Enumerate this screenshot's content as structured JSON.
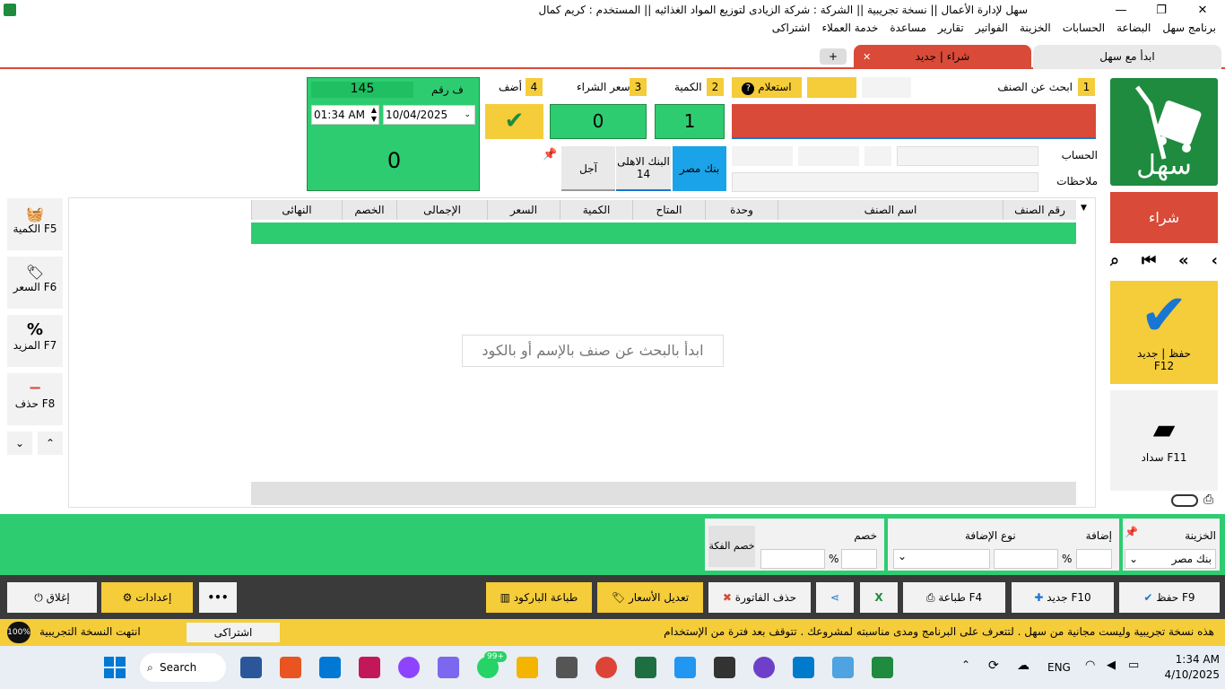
{
  "titlebar": {
    "title": "سهل لإدارة الأعمال   ||  نسخة تجريبية   ||   الشركة : شركة الزيادى لتوزيع المواد الغذائيه   ||   المستخدم : كريم كمال",
    "min": "—",
    "max": "❐",
    "close": "✕"
  },
  "menu": [
    "برنامج سهل",
    "البضاعة",
    "الحسابات",
    "الخزينة",
    "الفواتير",
    "تقارير",
    "مساعدة",
    "خدمة العملاء",
    "اشتراكى"
  ],
  "tabs": {
    "start": "ابدأ مع سهل",
    "active": "شراء | جديد",
    "close": "✕",
    "add": "+"
  },
  "sidebar": {
    "logo_text": "سهل",
    "buy": "شراء",
    "save_new": "حفظ | جديد",
    "save_key": "F12",
    "pay": "سداد F11"
  },
  "entry": {
    "n1": "1",
    "search_label": "ابحث عن الصنف",
    "inquiry": "استعلام",
    "n2": "2",
    "qty_label": "الكمية",
    "qty": "1",
    "n3": "3",
    "price_label": "سعر الشراء",
    "price": "0",
    "n4": "4",
    "add_label": "أضف",
    "account_label": "الحساب",
    "notes_label": "ملاحظات",
    "pay_ahel": "البنك الاهلى",
    "pay_ahel_num": "14",
    "pay_misr": "بنك مصر",
    "pay_credit": "آجل"
  },
  "invoice": {
    "no_label": "ف رقم",
    "no": "145",
    "date": "10/04/2025",
    "time": "01:34 AM",
    "total": "0"
  },
  "leftbtns": [
    {
      "label": "الكمية F5",
      "icon": "basket"
    },
    {
      "label": "السعر F6",
      "icon": "tag"
    },
    {
      "label": "المزيد F7",
      "icon": "percent"
    },
    {
      "label": "حذف F8",
      "icon": "minus"
    }
  ],
  "grid": {
    "cols": [
      "رقم الصنف",
      "اسم الصنف",
      "وحدة",
      "المتاح",
      "الكمية",
      "السعر",
      "الإجمالى",
      "الخصم",
      "النهائى"
    ],
    "placeholder": "ابدأ بالبحث عن صنف بالإسم أو بالكود"
  },
  "bottom": {
    "treasury_label": "الخزينة",
    "treasury": "بنك مصر",
    "addition_label": "إضافة",
    "add_type_label": "نوع الإضافة",
    "discount_label": "خصم",
    "change_discount": "خصم الفكة",
    "pct": "%"
  },
  "buttons": {
    "save": "حفظ F9",
    "new": "جديد F10",
    "print": "طباعة F4",
    "delete": "حذف الفاتورة",
    "edit_prices": "تعديل الأسعار",
    "barcode": "طباعة الباركود",
    "close": "إغلاق",
    "settings": "إعدادات",
    "more": "•••"
  },
  "status": {
    "msg": "هذه نسخة تجريبية وليست مجانية من سهل . لتتعرف على البرنامج ومدى مناسبته لمشروعك . تتوقف بعد فترة من الإستخدام",
    "subscribe": "اشتراكى",
    "expired": "انتهت النسخة التجريبية",
    "percent": "100%"
  },
  "taskbar": {
    "search": "Search",
    "lang": "ENG",
    "time": "1:34 AM",
    "date": "4/10/2025",
    "badge": "99+"
  }
}
